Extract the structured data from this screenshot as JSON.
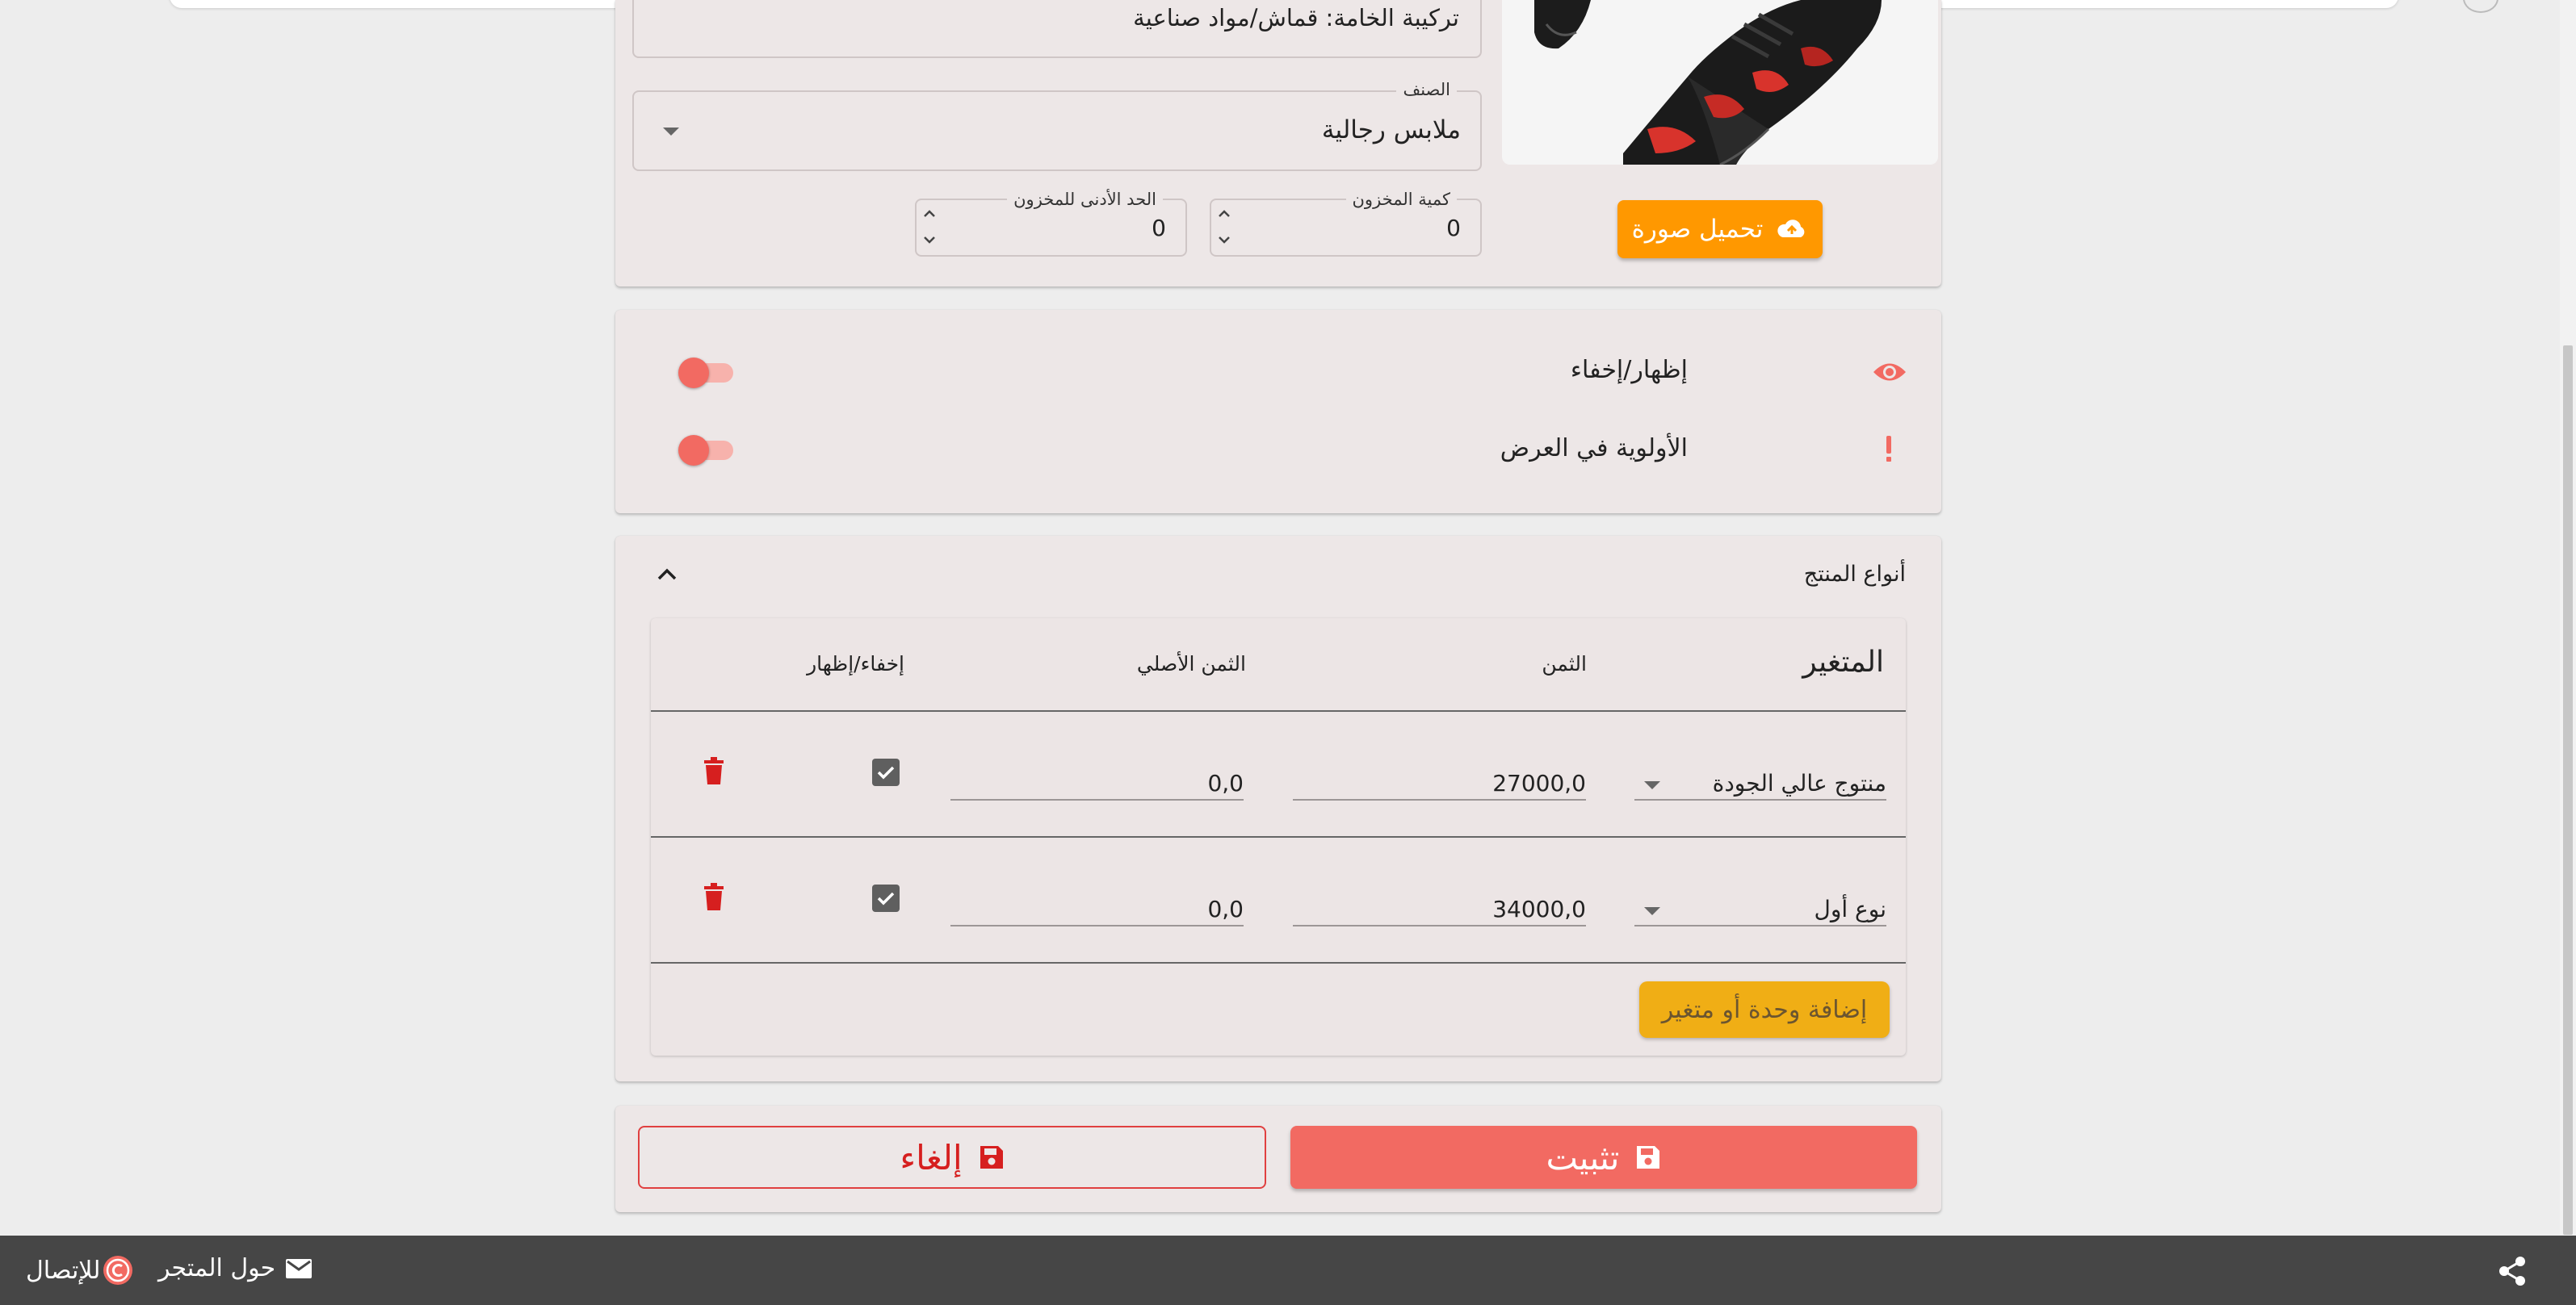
{
  "product_form": {
    "composition_text": "تركيبة الخامة: قماش/مواد صناعية",
    "category": {
      "label": "الصنف",
      "value": "ملابس رجالية"
    },
    "stock_qty": {
      "label": "كمية المخزون",
      "value": "0"
    },
    "min_stock": {
      "label": "الحد الأدنى للمخزون",
      "value": "0"
    },
    "upload_button": "تحميل صورة"
  },
  "visibility": {
    "show_hide_label": "إظهار/إخفاء",
    "priority_label": "الأولوية في العرض",
    "show_hide_on": false,
    "priority_on": false
  },
  "variants": {
    "section_title": "أنواع المنتج",
    "columns": {
      "variant": "المتغير",
      "price": "الثمن",
      "original_price": "الثمن الأصلي",
      "hide_show": "إخفاء/إظهار"
    },
    "rows": [
      {
        "variant": "منتوج عالي الجودة",
        "price": "27000,0",
        "original_price": "0,0",
        "visible": true
      },
      {
        "variant": "نوع أول",
        "price": "34000,0",
        "original_price": "0,0",
        "visible": true
      }
    ],
    "add_button": "إضافة وحدة أو متغير"
  },
  "actions": {
    "save_label": "تثبيت",
    "cancel_label": "إلغاء"
  },
  "footer": {
    "about_label": "حول المتجر",
    "contact_label": "للإتصال"
  },
  "colors": {
    "accent_red": "#f26a62",
    "upload_orange": "#ff9800",
    "add_yellow": "#f0ae15",
    "footer_bg": "#464646"
  }
}
